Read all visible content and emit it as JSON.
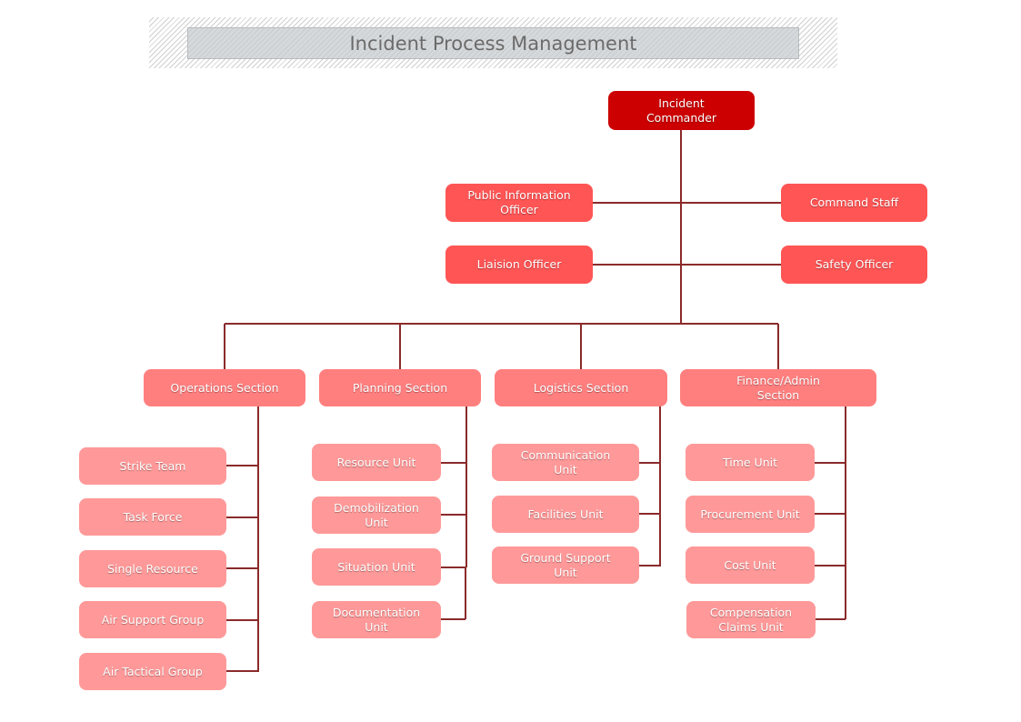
{
  "title": "Incident Process Management",
  "colors": {
    "commander": "#cc0000",
    "staff": "#ff5555",
    "section": "#ff7f7f",
    "unit": "#ff9999",
    "connector": "#8b2a2a"
  },
  "commander": {
    "label": "Incident Commander"
  },
  "staff": [
    {
      "label": "Public Information Officer"
    },
    {
      "label": "Command Staff"
    },
    {
      "label": "Liaision Officer"
    },
    {
      "label": "Safety Officer"
    }
  ],
  "sections": [
    {
      "label": "Operations Section",
      "units": [
        {
          "label": "Strike Team"
        },
        {
          "label": "Task Force"
        },
        {
          "label": "Single Resource"
        },
        {
          "label": "Air Support Group"
        },
        {
          "label": "Air Tactical Group"
        }
      ]
    },
    {
      "label": "Planning Section",
      "units": [
        {
          "label": "Resource Unit"
        },
        {
          "label": "Demobilization Unit"
        },
        {
          "label": "Situation Unit"
        },
        {
          "label": "Documentation Unit"
        }
      ]
    },
    {
      "label": "Logistics Section",
      "units": [
        {
          "label": "Communication Unit"
        },
        {
          "label": "Facilities Unit"
        },
        {
          "label": "Ground Support Unit"
        }
      ]
    },
    {
      "label": "Finance/Admin Section",
      "units": [
        {
          "label": "Time Unit"
        },
        {
          "label": "Procurement Unit"
        },
        {
          "label": "Cost Unit"
        },
        {
          "label": "Compensation Claims Unit"
        }
      ]
    }
  ]
}
